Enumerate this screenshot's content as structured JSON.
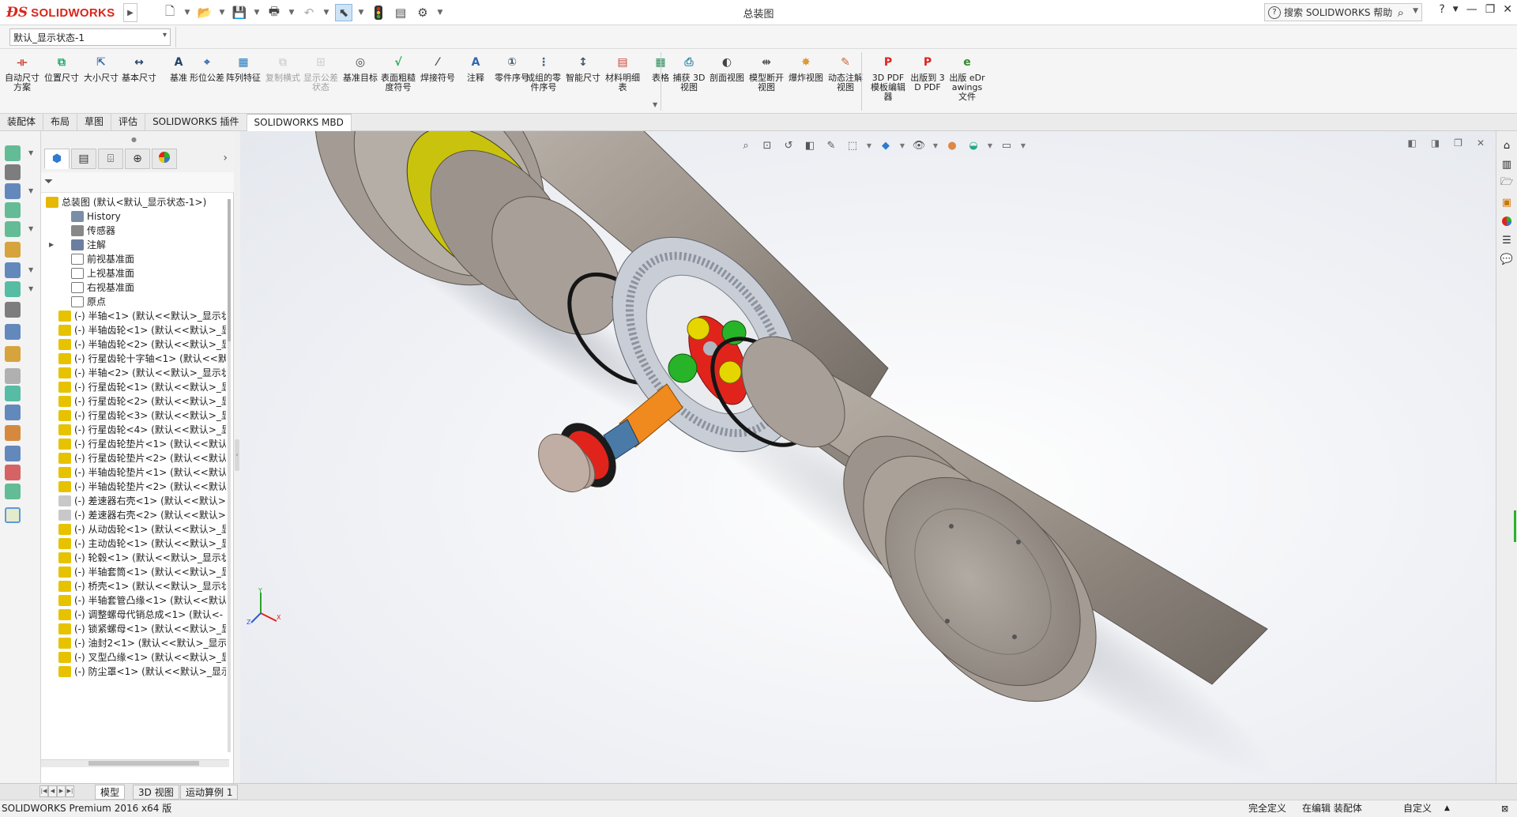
{
  "app": {
    "logo_text": "SOLIDWORKS",
    "document_title": "总装图",
    "help_search_placeholder": "搜索 SOLIDWORKS 帮助"
  },
  "display_state": {
    "value": "默认_显示状态-1"
  },
  "ribbon": {
    "buttons": [
      {
        "label": "自动尺寸方案",
        "icon": "auto-dimension-icon"
      },
      {
        "label": "位置尺寸",
        "icon": "location-dimension-icon"
      },
      {
        "label": "大小尺寸",
        "icon": "size-dimension-icon"
      },
      {
        "label": "基本尺寸",
        "icon": "basic-dimension-icon"
      },
      {
        "label": "基准",
        "icon": "datum-icon"
      },
      {
        "label": "形位公差",
        "icon": "geometric-tolerance-icon"
      },
      {
        "label": "阵列特征",
        "icon": "pattern-feature-icon"
      },
      {
        "label": "复制横式",
        "icon": "copy-scheme-icon",
        "disabled": true
      },
      {
        "label": "显示公差状态",
        "icon": "show-tolerance-status-icon",
        "disabled": true
      },
      {
        "label": "基准目标",
        "icon": "datum-target-icon"
      },
      {
        "label": "表面粗糙度符号",
        "icon": "surface-finish-icon"
      },
      {
        "label": "焊接符号",
        "icon": "weld-symbol-icon"
      },
      {
        "label": "注释",
        "icon": "note-icon"
      },
      {
        "label": "零件序号",
        "icon": "balloon-icon"
      },
      {
        "label": "成组的零件序号",
        "icon": "stacked-balloon-icon"
      },
      {
        "label": "智能尺寸",
        "icon": "smart-dimension-icon"
      },
      {
        "label": "材料明细表",
        "icon": "bill-of-materials-icon"
      },
      {
        "label": "表格",
        "icon": "table-icon"
      },
      {
        "label": "捕获 3D 视图",
        "icon": "capture-3d-view-icon"
      },
      {
        "label": "剖面视图",
        "icon": "section-view-icon"
      },
      {
        "label": "模型断开视图",
        "icon": "model-break-view-icon"
      },
      {
        "label": "爆炸视图",
        "icon": "exploded-view-icon"
      },
      {
        "label": "动态注解视图",
        "icon": "dynamic-annotation-views-icon"
      },
      {
        "label": "3D PDF 模板编辑器",
        "icon": "3d-pdf-template-editor-icon"
      },
      {
        "label": "出版到 3D PDF",
        "icon": "publish-3d-pdf-icon"
      },
      {
        "label": "出版 eDrawings 文件",
        "icon": "publish-edrawings-icon"
      }
    ]
  },
  "command_tabs": [
    "装配体",
    "布局",
    "草图",
    "评估",
    "SOLIDWORKS 插件",
    "SOLIDWORKS MBD"
  ],
  "command_tabs_active": "SOLIDWORKS MBD",
  "feature_tree": {
    "root": "总装图  (默认<默认_显示状态-1>)",
    "items": [
      {
        "label": "History",
        "icon": "history-icon",
        "level": 1
      },
      {
        "label": "传感器",
        "icon": "sensor-icon",
        "level": 1
      },
      {
        "label": "注解",
        "icon": "annotations-icon",
        "level": 1,
        "expandable": true
      },
      {
        "label": "前视基准面",
        "icon": "plane-icon",
        "level": 1
      },
      {
        "label": "上视基准面",
        "icon": "plane-icon",
        "level": 1
      },
      {
        "label": "右视基准面",
        "icon": "plane-icon",
        "level": 1
      },
      {
        "label": "原点",
        "icon": "origin-icon",
        "level": 1
      },
      {
        "label": "(-) 半轴<1> (默认<<默认>_显示状",
        "icon": "part-icon",
        "expandable": true
      },
      {
        "label": "(-) 半轴齿轮<1> (默认<<默认>_显",
        "icon": "part-icon",
        "expandable": true
      },
      {
        "label": "(-) 半轴齿轮<2> (默认<<默认>_显",
        "icon": "part-icon",
        "expandable": true
      },
      {
        "label": "(-) 行星齿轮十字轴<1> (默认<<默",
        "icon": "part-icon",
        "expandable": true
      },
      {
        "label": "(-) 半轴<2> (默认<<默认>_显示状",
        "icon": "part-icon",
        "expandable": true
      },
      {
        "label": "(-) 行星齿轮<1> (默认<<默认>_显",
        "icon": "part-icon",
        "expandable": true
      },
      {
        "label": "(-) 行星齿轮<2> (默认<<默认>_显",
        "icon": "part-icon",
        "expandable": true
      },
      {
        "label": "(-) 行星齿轮<3> (默认<<默认>_显",
        "icon": "part-icon",
        "expandable": true
      },
      {
        "label": "(-) 行星齿轮<4> (默认<<默认>_显",
        "icon": "part-icon",
        "expandable": true
      },
      {
        "label": "(-) 行星齿轮垫片<1> (默认<<默认",
        "icon": "part-icon",
        "expandable": true
      },
      {
        "label": "(-) 行星齿轮垫片<2> (默认<<默认",
        "icon": "part-icon",
        "expandable": true
      },
      {
        "label": "(-) 半轴齿轮垫片<1> (默认<<默认",
        "icon": "part-icon",
        "expandable": true
      },
      {
        "label": "(-) 半轴齿轮垫片<2> (默认<<默认",
        "icon": "part-icon",
        "expandable": true
      },
      {
        "label": "(-) 差速器右壳<1> (默认<<默认>",
        "icon": "subassembly-icon",
        "expandable": false
      },
      {
        "label": "(-) 差速器右壳<2> (默认<<默认>",
        "icon": "subassembly-icon",
        "expandable": false
      },
      {
        "label": "(-) 从动齿轮<1> (默认<<默认>_显",
        "icon": "part-icon",
        "expandable": true
      },
      {
        "label": "(-) 主动齿轮<1> (默认<<默认>_显",
        "icon": "part-icon",
        "expandable": true
      },
      {
        "label": "(-) 轮毂<1> (默认<<默认>_显示状",
        "icon": "part-icon",
        "expandable": true
      },
      {
        "label": "(-) 半轴套筒<1> (默认<<默认>_显",
        "icon": "part-icon",
        "expandable": true
      },
      {
        "label": "(-) 桥壳<1> (默认<<默认>_显示状",
        "icon": "part-icon",
        "expandable": true
      },
      {
        "label": "(-) 半轴套管凸缘<1> (默认<<默认",
        "icon": "part-icon",
        "expandable": true
      },
      {
        "label": "(-) 调整螺母代销总成<1> (默认<-",
        "icon": "part-icon",
        "expandable": true
      },
      {
        "label": "(-) 锁紧螺母<1> (默认<<默认>_显",
        "icon": "part-icon",
        "expandable": true
      },
      {
        "label": "(-) 油封2<1> (默认<<默认>_显示",
        "icon": "part-icon",
        "expandable": true
      },
      {
        "label": "(-) 叉型凸缘<1> (默认<<默认>_显",
        "icon": "part-icon",
        "expandable": true
      },
      {
        "label": "(-) 防尘罩<1> (默认<<默认>_显示",
        "icon": "part-icon",
        "expandable": true
      }
    ]
  },
  "bottom_tabs": [
    "模型",
    "3D 视图",
    "运动算例 1"
  ],
  "bottom_tabs_active": "模型",
  "status_bar": {
    "version": "SOLIDWORKS Premium 2016 x64 版",
    "definition": "完全定义",
    "editing": "在编辑 装配体",
    "units": "自定义"
  },
  "colors": {
    "brand_red": "#d9261c",
    "housing": "#9d948c",
    "gear": "#c9ced6",
    "accent_yellow": "#e6d600",
    "accent_red": "#e0241c",
    "accent_green": "#28b428",
    "accent_orange": "#f08a1e"
  }
}
